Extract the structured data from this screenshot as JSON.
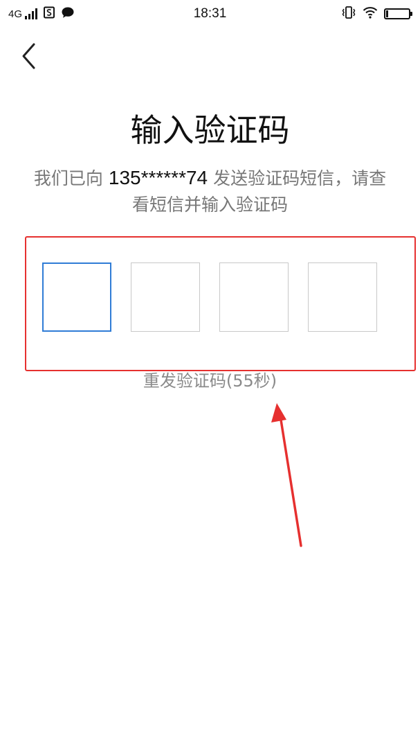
{
  "status_bar": {
    "network": "4G",
    "time": "18:31",
    "battery_level": 0.1,
    "icons": [
      "signal-icon",
      "sim-icon",
      "chat-icon",
      "vibrate-icon",
      "wifi-icon",
      "battery-icon"
    ]
  },
  "header": {
    "back_icon": "chevron-left-icon"
  },
  "main": {
    "title": "输入验证码",
    "description_prefix": "我们已向",
    "phone_number": "135******74",
    "description_suffix": "发送验证码短信，请查看短信并输入验证码",
    "code_boxes": [
      "",
      "",
      "",
      ""
    ],
    "active_box": 0,
    "resend_label": "重发验证码(55秒)"
  },
  "colors": {
    "accent": "#2f7cd6",
    "annotation": "#e6302f",
    "muted_text": "#777777"
  }
}
